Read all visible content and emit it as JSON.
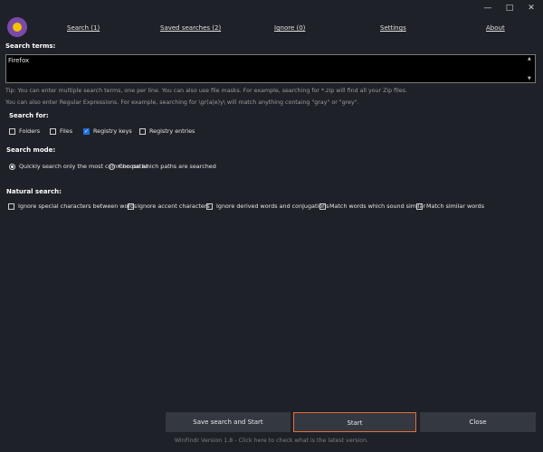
{
  "window": {
    "minimize": "—",
    "maximize": "□",
    "close": "✕"
  },
  "nav": {
    "items": [
      {
        "label": "Search (1)"
      },
      {
        "label": "Saved searches (2)"
      },
      {
        "label": "Ignore (0)"
      },
      {
        "label": "Settings"
      },
      {
        "label": "About"
      }
    ]
  },
  "search_terms": {
    "label": "Search terms:",
    "value": "Firefox",
    "tip1": "Tip: You can enter multiple search terms, one per line. You can also use file masks. For example, searching for *.zip will find all your Zip files.",
    "tip2": "You can also enter Regular Expressions. For example, searching for \\gr(a|e)y\\ will match anything containg \"gray\" or \"grey\"."
  },
  "search_for": {
    "label": "Search for:",
    "options": [
      {
        "label": "Folders",
        "checked": false
      },
      {
        "label": "Files",
        "checked": false
      },
      {
        "label": "Registry keys",
        "checked": true
      },
      {
        "label": "Registry entries",
        "checked": false
      }
    ]
  },
  "search_mode": {
    "label": "Search mode:",
    "options": [
      {
        "label": "Quickly search only the most common paths",
        "selected": true
      },
      {
        "label": "Choose which paths are searched",
        "selected": false
      }
    ]
  },
  "natural_search": {
    "label": "Natural search:",
    "options": [
      {
        "label": "Ignore special characters between words",
        "checked": false
      },
      {
        "label": "Ignore accent characters",
        "checked": false
      },
      {
        "label": "Ignore derived words and conjugations",
        "checked": false
      },
      {
        "label": "Match words which sound similar",
        "checked": false
      },
      {
        "label": "Match similar words",
        "checked": false
      }
    ]
  },
  "buttons": {
    "save_start": "Save search and Start",
    "start": "Start",
    "close": "Close"
  },
  "footer": "WinFindr Version 1.8 - Click here to check what is the latest version.",
  "colors": {
    "accent": "#1e6fd8",
    "start_border": "#e2703a",
    "background": "#1f2128"
  }
}
